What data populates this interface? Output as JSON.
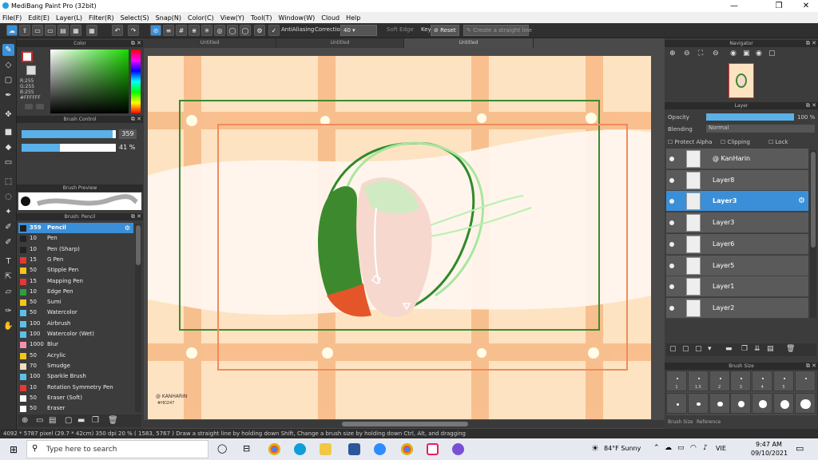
{
  "window": {
    "title": "MediBang Paint Pro (32bit)"
  },
  "menu": [
    "File(F)",
    "Edit(E)",
    "Layer(L)",
    "Filter(R)",
    "Select(S)",
    "Snap(N)",
    "Color(C)",
    "View(Y)",
    "Tool(T)",
    "Window(W)",
    "Cloud",
    "Help"
  ],
  "toolbar": {
    "antialiasing": "AntiAliasing",
    "correction_label": "Correction",
    "correction_value": "40",
    "soft_edge": "Soft Edge",
    "key": "Key",
    "reset": "Reset",
    "straight_line": "Create a straight line"
  },
  "tabs": [
    "Untitled",
    "Untitled",
    "Untitled"
  ],
  "color_panel": {
    "title": "Color",
    "r": "R:255",
    "g": "G:255",
    "b": "B:255",
    "hex": "#FFFFFF"
  },
  "brush_control": {
    "title": "Brush Control",
    "size": "359",
    "opacity": "41 %",
    "size_fill": 0.97,
    "opacity_fill": 0.41
  },
  "brush_preview": {
    "title": "Brush Preview",
    "size": "359"
  },
  "brush_list": {
    "title": "Brush: Pencil",
    "items": [
      {
        "num": "359",
        "name": "Pencil",
        "color": "#1e1e1e",
        "selected": true
      },
      {
        "num": "10",
        "name": "Pen",
        "color": "#222222"
      },
      {
        "num": "10",
        "name": "Pen (Sharp)",
        "color": "#222222"
      },
      {
        "num": "15",
        "name": "G Pen",
        "color": "#e53935"
      },
      {
        "num": "50",
        "name": "Stipple Pen",
        "color": "#f5c518"
      },
      {
        "num": "15",
        "name": "Mapping Pen",
        "color": "#e53935"
      },
      {
        "num": "10",
        "name": "Edge Pen",
        "color": "#2e9e3e"
      },
      {
        "num": "50",
        "name": "Sumi",
        "color": "#f5c518"
      },
      {
        "num": "50",
        "name": "Watercolor",
        "color": "#5bc0eb"
      },
      {
        "num": "100",
        "name": "Airbrush",
        "color": "#5bc0eb"
      },
      {
        "num": "100",
        "name": "Watercolor (Wet)",
        "color": "#5bc0eb"
      },
      {
        "num": "1000",
        "name": "Blur",
        "color": "#f48fb1"
      },
      {
        "num": "50",
        "name": "Acrylic",
        "color": "#f5c518"
      },
      {
        "num": "70",
        "name": "Smudge",
        "color": "#f0e0c0"
      },
      {
        "num": "100",
        "name": "Sparkle Brush",
        "color": "#5bc0eb"
      },
      {
        "num": "10",
        "name": "Rotation Symmetry Pen",
        "color": "#e53935"
      },
      {
        "num": "50",
        "name": "Eraser (Soft)",
        "color": "#ffffff"
      },
      {
        "num": "50",
        "name": "Eraser",
        "color": "#ffffff"
      }
    ]
  },
  "navigator": {
    "title": "Navigator"
  },
  "layer_panel": {
    "title": "Layer",
    "opacity_label": "Opacity",
    "opacity_value": "100 %",
    "blending_label": "Blending",
    "blending_value": "Normal",
    "protect_alpha": "Protect Alpha",
    "clipping": "Clipping",
    "lock": "Lock",
    "layers": [
      {
        "name": "@ KanHarin",
        "selected": false
      },
      {
        "name": "Layer8",
        "selected": false
      },
      {
        "name": "Layer3",
        "selected": true
      },
      {
        "name": "Layer3",
        "selected": false
      },
      {
        "name": "Layer6",
        "selected": false
      },
      {
        "name": "Layer5",
        "selected": false
      },
      {
        "name": "Layer1",
        "selected": false
      },
      {
        "name": "Layer2",
        "selected": false
      }
    ]
  },
  "brush_size": {
    "title": "Brush Size",
    "labels": [
      "1",
      "1.5",
      "2",
      "3",
      "4",
      "5"
    ],
    "tabs": [
      "Brush Size",
      "Reference"
    ]
  },
  "canvas": {
    "signature": "@ KANHARIN\n#HD247"
  },
  "status": {
    "text": "4092 * 5787 pixel  (29.7 * 42cm)  350 dpi  20 %  ( 1583, 5767 )  Draw a straight line by holding down Shift, Change a brush size by holding down Ctrl, Alt, and dragging"
  },
  "taskbar": {
    "search": "Type here to search",
    "weather": "84°F Sunny",
    "lang": "VIE",
    "time": "9:47 AM",
    "date": "09/10/2021"
  }
}
